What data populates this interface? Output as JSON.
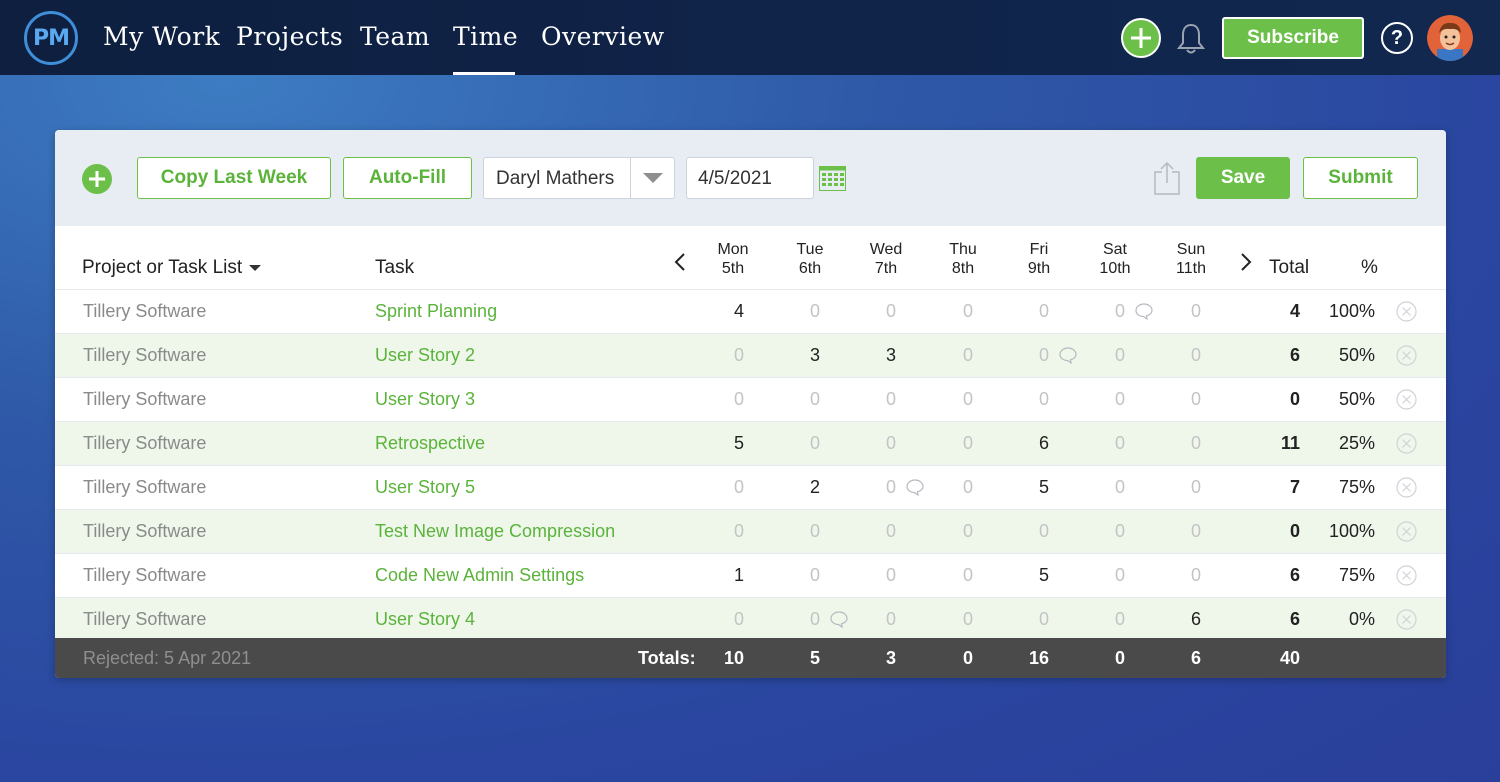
{
  "nav": {
    "logo": "PM",
    "items": [
      "My Work",
      "Projects",
      "Team",
      "Time",
      "Overview"
    ],
    "active": "Time",
    "subscribe_label": "Subscribe",
    "help_label": "?"
  },
  "colors": {
    "accent": "#6cc04a",
    "nav_bg": "#10244a",
    "alt_row": "#eef7ea",
    "footer_bg": "#4a4a4a"
  },
  "toolbar": {
    "copy_last_week": "Copy Last Week",
    "auto_fill": "Auto-Fill",
    "user_select": "Daryl Mathers",
    "date": "4/5/2021",
    "save_label": "Save",
    "submit_label": "Submit"
  },
  "table": {
    "col_project": "Project or Task List",
    "col_task": "Task",
    "days": [
      {
        "day": "Mon",
        "date": "5th"
      },
      {
        "day": "Tue",
        "date": "6th"
      },
      {
        "day": "Wed",
        "date": "7th"
      },
      {
        "day": "Thu",
        "date": "8th"
      },
      {
        "day": "Fri",
        "date": "9th"
      },
      {
        "day": "Sat",
        "date": "10th"
      },
      {
        "day": "Sun",
        "date": "11th"
      }
    ],
    "col_total": "Total",
    "col_pct": "%",
    "rows": [
      {
        "project": "Tillery Software",
        "task": "Sprint Planning",
        "hours": [
          "4",
          "0",
          "0",
          "0",
          "0",
          "0",
          "0"
        ],
        "comment_after": 5,
        "total": "4",
        "pct": "100%"
      },
      {
        "project": "Tillery Software",
        "task": "User Story 2",
        "hours": [
          "0",
          "3",
          "3",
          "0",
          "0",
          "0",
          "0"
        ],
        "comment_after": 4,
        "total": "6",
        "pct": "50%"
      },
      {
        "project": "Tillery Software",
        "task": "User Story 3",
        "hours": [
          "0",
          "0",
          "0",
          "0",
          "0",
          "0",
          "0"
        ],
        "comment_after": -1,
        "total": "0",
        "pct": "50%"
      },
      {
        "project": "Tillery Software",
        "task": "Retrospective",
        "hours": [
          "5",
          "0",
          "0",
          "0",
          "6",
          "0",
          "0"
        ],
        "comment_after": -1,
        "total": "11",
        "pct": "25%"
      },
      {
        "project": "Tillery Software",
        "task": "User Story 5",
        "hours": [
          "0",
          "2",
          "0",
          "0",
          "5",
          "0",
          "0"
        ],
        "comment_after": 2,
        "total": "7",
        "pct": "75%"
      },
      {
        "project": "Tillery Software",
        "task": "Test New Image Compression",
        "hours": [
          "0",
          "0",
          "0",
          "0",
          "0",
          "0",
          "0"
        ],
        "comment_after": -1,
        "total": "0",
        "pct": "100%"
      },
      {
        "project": "Tillery Software",
        "task": "Code New Admin Settings",
        "hours": [
          "1",
          "0",
          "0",
          "0",
          "5",
          "0",
          "0"
        ],
        "comment_after": -1,
        "total": "6",
        "pct": "75%"
      },
      {
        "project": "Tillery Software",
        "task": "User Story 4",
        "hours": [
          "0",
          "0",
          "0",
          "0",
          "0",
          "0",
          "6"
        ],
        "comment_after": 1,
        "total": "6",
        "pct": "0%"
      }
    ],
    "footer": {
      "status": "Rejected: 5 Apr 2021",
      "totals_label": "Totals:",
      "day_totals": [
        "10",
        "5",
        "3",
        "0",
        "16",
        "0",
        "6"
      ],
      "grand_total": "40"
    }
  }
}
